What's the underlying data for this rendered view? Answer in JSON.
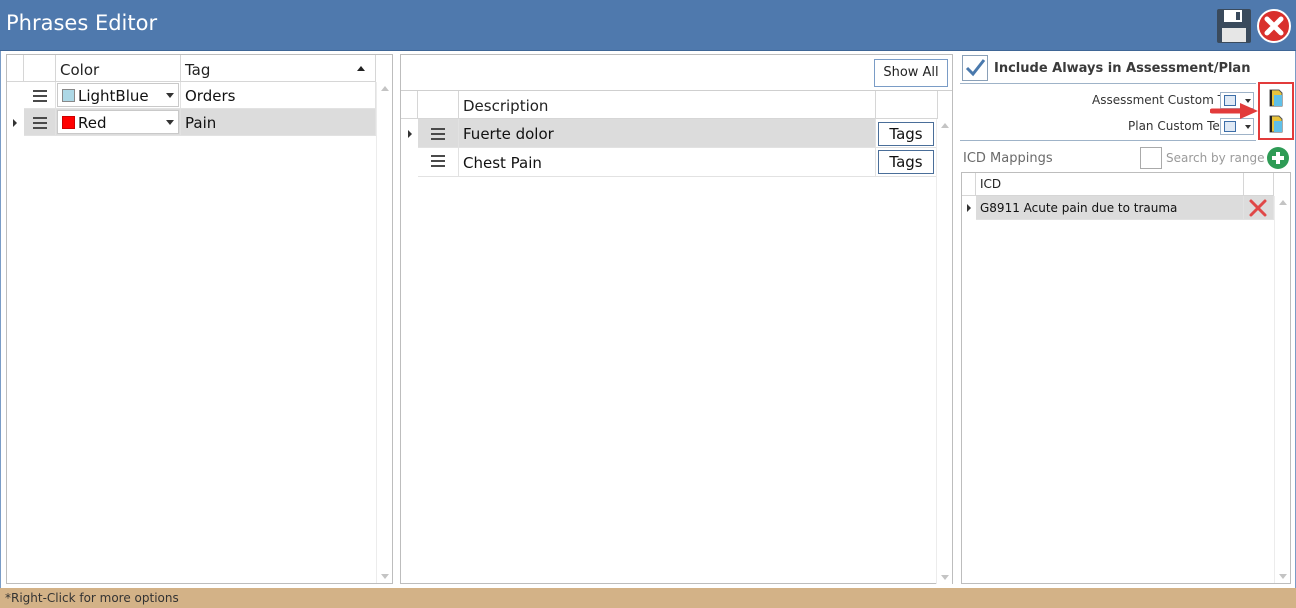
{
  "window": {
    "title": "Phrases Editor"
  },
  "tags_grid": {
    "columns": [
      "Color",
      "Tag"
    ],
    "rows": [
      {
        "color_name": "LightBlue",
        "swatch": "#add8e6",
        "tag": "Orders"
      },
      {
        "color_name": "Red",
        "swatch": "#ff0000",
        "tag": "Pain"
      }
    ]
  },
  "phrases": {
    "show_all_label": "Show All",
    "columns": [
      "Description"
    ],
    "rows": [
      {
        "description": "Fuerte dolor",
        "tags_label": "Tags"
      },
      {
        "description": "Chest Pain",
        "tags_label": "Tags"
      }
    ]
  },
  "details": {
    "include_label": "Include Always in Assessment/Plan",
    "assessment_label": "Assessment Custom Text:",
    "plan_label": "Plan Custom Text:",
    "icd_title": "ICD Mappings",
    "search_by_range_label": "Search by range",
    "icd_column": "ICD",
    "icd_rows": [
      {
        "text": "G8911 Acute pain due to trauma"
      }
    ]
  },
  "status": {
    "text": "*Right-Click for more options"
  },
  "colors": {
    "titlebar": "#4f79ad",
    "status_bar": "#d3b287",
    "highlight": "#e23b3b",
    "add": "#2e9b55"
  },
  "icons": [
    "save-icon",
    "close-icon",
    "hamburger-icon",
    "add-icon",
    "delete-icon",
    "document-icon",
    "arrow-annotation"
  ]
}
